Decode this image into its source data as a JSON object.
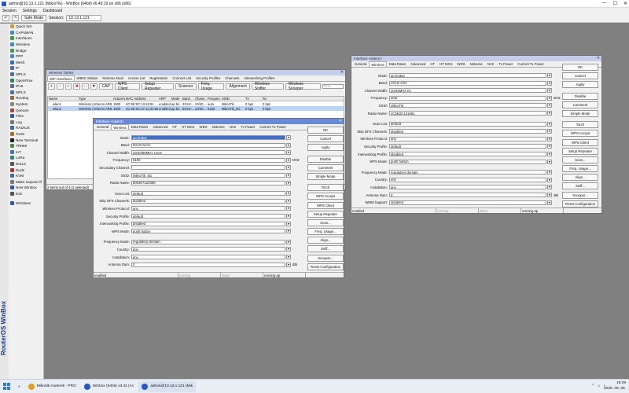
{
  "app": {
    "title": "admin@10.13.1.121 (MikroTik) - WinBox (64bit) v6.49.19 on x86 (x86)",
    "close": "✕",
    "minimize": "—",
    "maximize": "☐"
  },
  "menubar": [
    "Session",
    "Settings",
    "Dashboard"
  ],
  "toolbar": {
    "undo": "↶",
    "redo": "↷",
    "safe_mode": "Safe Mode",
    "session_label": "Session:",
    "session_value": "10.13.1.121"
  },
  "sidebar": {
    "brand": "RouterOS WinBox",
    "items": [
      {
        "label": "Quick Set",
        "color": "#d9a020"
      },
      {
        "label": "CAPsMAN",
        "color": "#3b8ed6"
      },
      {
        "label": "Interfaces",
        "color": "#3aa04a"
      },
      {
        "label": "Wireless",
        "color": "#3b8ed6"
      },
      {
        "label": "Bridge",
        "color": "#3aa04a"
      },
      {
        "label": "PPP",
        "color": "#3b8ed6"
      },
      {
        "label": "Mesh",
        "color": "#2a72c8"
      },
      {
        "label": "IP",
        "color": "#5070a8"
      },
      {
        "label": "MPLS",
        "color": "#5070a8"
      },
      {
        "label": "OpenFlow",
        "color": "#2a8a60"
      },
      {
        "label": "IPv6",
        "color": "#5070a8"
      },
      {
        "label": "MPLS",
        "color": "#5070a8"
      },
      {
        "label": "Routing",
        "color": "#9a6a30"
      },
      {
        "label": "System",
        "color": "#888888"
      },
      {
        "label": "Queues",
        "color": "#c04040"
      },
      {
        "label": "Files",
        "color": "#2a5bb5"
      },
      {
        "label": "Log",
        "color": "#777777"
      },
      {
        "label": "RADIUS",
        "color": "#3a6aa8"
      },
      {
        "label": "Tools",
        "color": "#b07020"
      },
      {
        "label": "New Terminal",
        "color": "#222222"
      },
      {
        "label": "TR069",
        "color": "#4a8a4a"
      },
      {
        "label": "IoT",
        "color": "#3a7ac8"
      },
      {
        "label": "LoRa",
        "color": "#2a8a8a"
      },
      {
        "label": "Dot1X",
        "color": "#555555"
      },
      {
        "label": "Dude",
        "color": "#c03030"
      },
      {
        "label": "KVM",
        "color": "#3b6eb5"
      },
      {
        "label": "Make Supout.rif",
        "color": "#7a7a7a"
      },
      {
        "label": "New WinBox",
        "color": "#2a56c6"
      },
      {
        "label": "Exit",
        "color": "#555555"
      },
      {
        "label": "Windows",
        "color": "#2a56c6"
      }
    ]
  },
  "wireless_tables": {
    "title": "Wireless Tables",
    "tabs": [
      "WiFi Interfaces",
      "W60G Station",
      "Nstreme Dual",
      "Access List",
      "Registration",
      "Connect List",
      "Security Profiles",
      "Channels",
      "Interworking Profiles"
    ],
    "tool_buttons": [
      "CAP",
      "WPS Client",
      "Setup Repeater",
      "Scanner",
      "Freq. Usage",
      "Alignment",
      "Wireless Sniffer",
      "Wireless Snooper"
    ],
    "find_placeholder": "Find",
    "columns": [
      "Name",
      "Type",
      "Actual MTU",
      "MAC Address",
      "ARP",
      "Mode",
      "Band",
      "Chann...",
      "Frequen...",
      "SSID",
      "Tx",
      "Rx"
    ],
    "rows": [
      [
        "wlan1",
        "Wireless (Atheros AR9...",
        "1500",
        "4C:5E:0C:13:15:91",
        "enabled",
        "ap bri...",
        "2GHz-...",
        "20/40...",
        "auto",
        "MikroTik",
        "0 bps",
        "0 bps"
      ],
      [
        "wlan2",
        "Wireless (Atheros AR9...",
        "1500",
        "4C:5E:0C:07:12:34:56",
        "enabled",
        "ap bri...",
        "5GHz-...",
        "20/40...",
        "5180",
        "MikroTik_5G",
        "0 bps",
        "0 bps"
      ]
    ],
    "status": "2 items out of 4 (1 selected)"
  },
  "wlan2": {
    "title": "Interface <wlan2>",
    "tabs": [
      "General",
      "Wireless",
      "Data Rates",
      "Advanced",
      "HT",
      "HT MCS",
      "WDS",
      "Nstreme",
      "NV2",
      "Tx Power",
      "Current Tx Power"
    ],
    "fields": [
      {
        "label": "Mode:",
        "value": "ap bridge",
        "selected": true
      },
      {
        "label": "Band:",
        "value": "5GHz-N/AC"
      },
      {
        "label": "Channel Width:",
        "value": "20/40/80MHz Ceee"
      },
      {
        "label": "Frequency:",
        "value": "5180",
        "unit": "MHz"
      },
      {
        "label": "Secondary Channel:",
        "value": ""
      },
      {
        "label": "SSID:",
        "value": "MikroTik_5G"
      },
      {
        "label": "Radio Name:",
        "value": "000307123456"
      },
      {
        "label": "Scan List:",
        "value": "default"
      },
      {
        "label": "Skip DFS Channels:",
        "value": "disabled"
      },
      {
        "label": "Wireless Protocol:",
        "value": "any"
      },
      {
        "label": "Security Profile:",
        "value": "default"
      },
      {
        "label": "Interworking Profile:",
        "value": "disabled"
      },
      {
        "label": "WPS Mode:",
        "value": "push button"
      },
      {
        "label": "Frequency Mode:",
        "value": "regulatory-domain"
      },
      {
        "label": "Country:",
        "value": "etsi"
      },
      {
        "label": "Installation:",
        "value": "any"
      },
      {
        "label": "Antenna Gain:",
        "value": "0",
        "unit": "dBi"
      }
    ],
    "buttons": [
      "OK",
      "Cancel",
      "Apply",
      "Disable",
      "Comment",
      "Simple Mode",
      "Torch",
      "WPS Accept",
      "WPS Client",
      "Setup Repeater",
      "Scan...",
      "Freq. Usage...",
      "Align...",
      "Sniff...",
      "Snooper...",
      "Reset Configuration"
    ],
    "status": [
      "enabled",
      "running",
      "slave",
      "running ap"
    ]
  },
  "wlan1": {
    "title": "Interface <wlan1>",
    "tabs": [
      "General",
      "Wireless",
      "Data Rates",
      "Advanced",
      "HT",
      "HT MCS",
      "WDS",
      "Nstreme",
      "NV2",
      "Tx Power",
      "Current Tx Power"
    ],
    "fields": [
      {
        "label": "Mode:",
        "value": "ap bridge"
      },
      {
        "label": "Band:",
        "value": "2GHz-G/N"
      },
      {
        "label": "Channel Width:",
        "value": "20/40MHz eC"
      },
      {
        "label": "Frequency:",
        "value": "auto",
        "unit": "MHz"
      },
      {
        "label": "SSID:",
        "value": "MikroTik"
      },
      {
        "label": "Radio Name:",
        "value": "4C5E0C131591"
      },
      {
        "label": "Scan List:",
        "value": "default"
      },
      {
        "label": "Skip DFS Channels:",
        "value": "disabled"
      },
      {
        "label": "Wireless Protocol:",
        "value": "any"
      },
      {
        "label": "Security Profile:",
        "value": "default"
      },
      {
        "label": "Interworking Profile:",
        "value": "disabled"
      },
      {
        "label": "WPS Mode:",
        "value": "push button"
      },
      {
        "label": "Frequency Mode:",
        "value": "regulatory-domain"
      },
      {
        "label": "Country:",
        "value": "etsi"
      },
      {
        "label": "Installation:",
        "value": "any"
      },
      {
        "label": "Antenna Gain:",
        "value": "0",
        "unit": "dBi"
      },
      {
        "label": "WMM Support:",
        "value": "disabled"
      }
    ],
    "buttons": [
      "OK",
      "Cancel",
      "Apply",
      "Disable",
      "Comment",
      "Simple Mode",
      "Torch",
      "WPS Accept",
      "WPS Client",
      "Setup Repeater",
      "Scan...",
      "Freq. Usage...",
      "Align...",
      "Sniff...",
      "Snooper...",
      "Reset Configuration"
    ],
    "status": [
      "enabled",
      "running",
      "slave",
      "running ap"
    ]
  },
  "taskbar": {
    "items": [
      {
        "label": "Mikrotik routerek - PRO",
        "color": "#e0a020"
      },
      {
        "label": "Winbox (64bit) v3.42 (Ac",
        "color": "#2a56c6"
      },
      {
        "label": "admin@10.13.1.121 (Mik",
        "color": "#2a56c6"
      }
    ],
    "time": "19:29",
    "date": "2025. 06. 06."
  }
}
